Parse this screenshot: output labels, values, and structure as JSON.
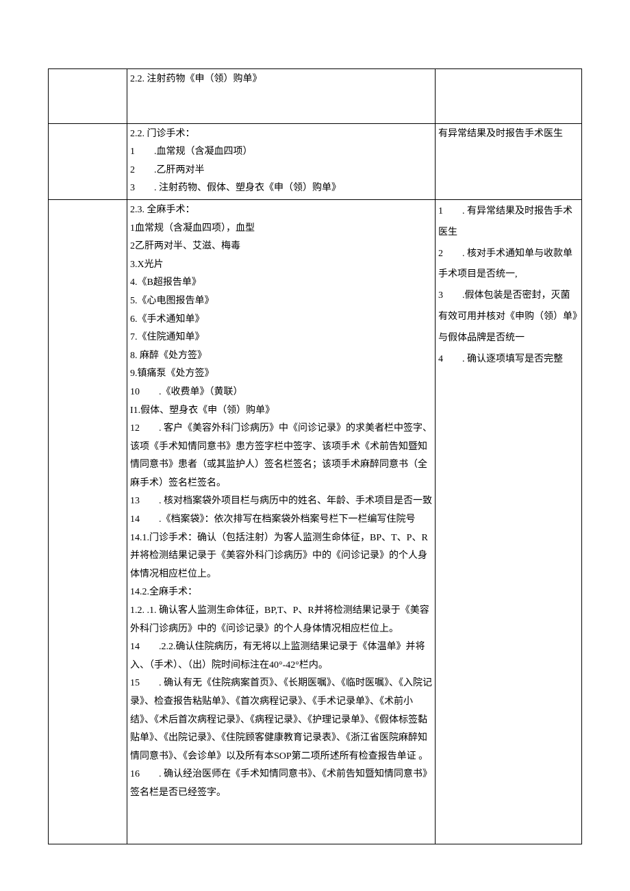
{
  "rows": [
    {
      "col1": "",
      "col2": [
        "2.2. 注射药物《申（领）购单》"
      ],
      "col3": [],
      "col2_padbottom": "50px"
    },
    {
      "col1": "",
      "col2": [
        "2.2. 门诊手术：",
        "1　　.血常规（含凝血四项）",
        "2　　.乙肝两对半",
        "3　　. 注射药物、假体、塑身衣《申（领）购单》"
      ],
      "col3": [
        "有异常结果及时报告手术医生"
      ]
    },
    {
      "col1": "",
      "col2": [
        "2.3. 全麻手术：",
        "1血常规（含凝血四项），血型",
        "2乙肝两对半、艾滋、梅毒",
        "3.X光片",
        "4.《B超报告单》",
        "5.《心电图报告单》",
        "6.《手术通知单》",
        "7.《住院通知单》",
        "8. 麻醉《处方签》",
        "9.镇痛泵《处方签》",
        "10　　.《收费单》（黄联）",
        "I1.假体、塑身衣《申（领）购单》",
        "12　　. 客户《美容外科门诊病历》中《问诊记录》的求美者栏中签字、该项《手术知情同意书》患方签字栏中签字、该项手术《术前告知暨知情同意书》患者（或其监护人）签名栏签名；该项手术麻醉同意书（全麻手术）签名栏签名。",
        "13　　. 核对档案袋外项目栏与病历中的姓名、年龄、手术项目是否一致",
        "14　　.《档案袋》：依次排写在档案袋外档案号栏下一栏编写住院号",
        "14.1.门诊手术：确认（包括注射）为客人监测生命体征，BP、T、P、R并将检测结果记录于《美容外科门诊病历》中的《问诊记录》的个人身体情况相应栏位上。",
        "14.2.全麻手术：",
        "1.2. .1. 确认客人监测生命体征，BP,T、P、R并将检测结果记录于《美容外科门诊病历》中的《问诊记录》的个人身体情况相应栏位上。",
        "14　　.2.2.确认住院病历，有无将以上监测结果记录于《体温单》并将入、（手术）、（出）院时间标注在40°-42°栏内。",
        "15　　. 确认有无《住院病案首页》、《长期医嘱》、《临时医嘱》、《入院记录》、检查报告粘贴单》、《首次病程记录》、《手术记录单》、《术前小结》、《术后首次病程记录》、《病程记录》、《护理记录单》、《假体标签黏贴单》、《出院记录》、《住院顾客健康教育记录表》、《浙江省医院麻醉知情同意书》、《会诊单》以及所有本SOP第二项所述所有检查报告单证 。",
        "16　　. 确认经治医师在《手术知情同意书》、《术前告知暨知情同意书》签名栏是否已经签字。"
      ],
      "col2_padbottom": "60px",
      "col3": [
        "1　　. 有异常结果及时报告手术医生",
        "2　　. 核对手术通知单与收款单手术项目是否统一,",
        "3　　.假体包装是否密封，灭菌有效可用并核对《申购（领）单》与假体品牌是否统一",
        "4　　. 确认逐项填写是否完整"
      ],
      "col3_loose": true
    }
  ]
}
